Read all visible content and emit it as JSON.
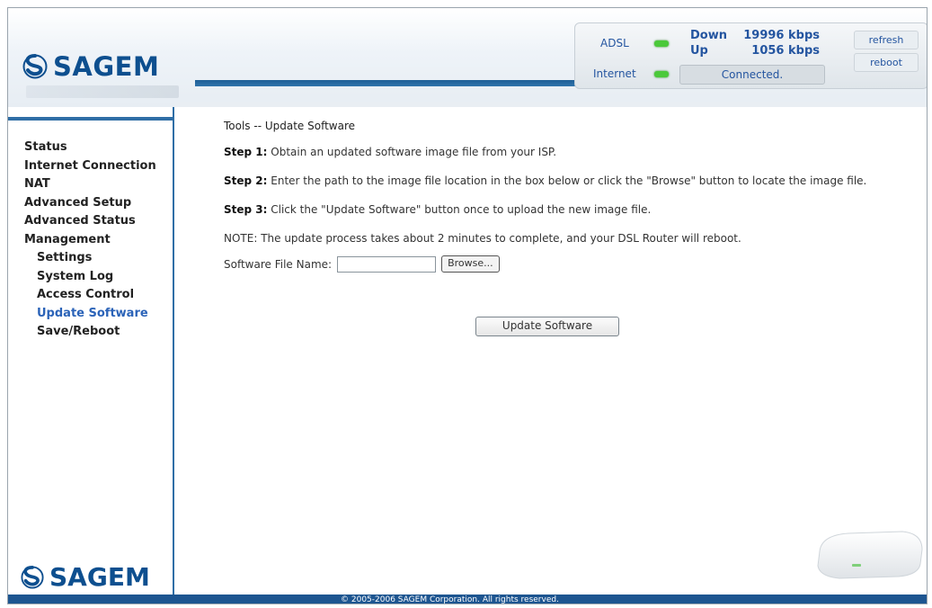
{
  "brand": {
    "name": "SAGEM"
  },
  "status_panel": {
    "adsl_label": "ADSL",
    "internet_label": "Internet",
    "down_label": "Down",
    "down_value": "19996 kbps",
    "up_label": "Up",
    "up_value": "1056 kbps",
    "connection_status": "Connected.",
    "refresh_label": "refresh",
    "reboot_label": "reboot",
    "led_color": "#4bc93a"
  },
  "sidebar": {
    "items": [
      {
        "label": "Status"
      },
      {
        "label": "Internet Connection"
      },
      {
        "label": "NAT"
      },
      {
        "label": "Advanced Setup"
      },
      {
        "label": "Advanced Status"
      },
      {
        "label": "Management"
      }
    ],
    "sub_items": [
      {
        "label": "Settings"
      },
      {
        "label": "System Log"
      },
      {
        "label": "Access Control"
      },
      {
        "label": "Update Software"
      },
      {
        "label": "Save/Reboot"
      }
    ]
  },
  "main": {
    "title": "Tools -- Update Software",
    "step1_label": "Step 1:",
    "step1_text": " Obtain an updated software image file from your ISP.",
    "step2_label": "Step 2:",
    "step2_text": " Enter the path to the image file location in the box below or click the \"Browse\" button to locate the image file.",
    "step3_label": "Step 3:",
    "step3_text": " Click the \"Update Software\" button once to upload the new image file.",
    "note": "NOTE: The update process takes about 2 minutes to complete, and your DSL Router will reboot.",
    "file_label": "Software File Name:",
    "file_value": "",
    "browse_label": "Browse...",
    "update_button": "Update Software"
  },
  "footer": {
    "text": "© 2005-2006 SAGEM Corporation. All rights reserved."
  },
  "colors": {
    "accent": "#1d5590",
    "nav_selected": "#2b63b8"
  }
}
